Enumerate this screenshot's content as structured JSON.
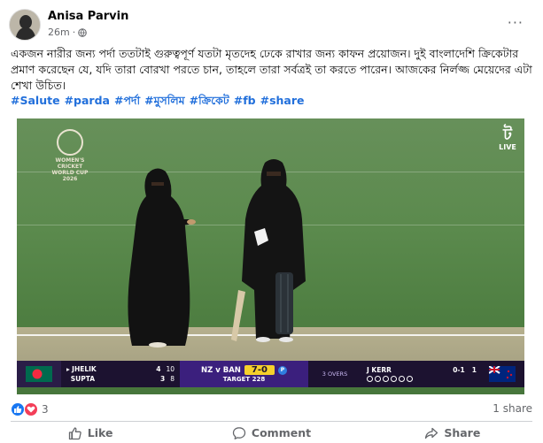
{
  "post": {
    "author": "Anisa Parvin",
    "time": "26m",
    "separator": "·",
    "more_label": "···",
    "text": "একজন নারীর জন্য পর্দা ততটাই গুরুত্বপূর্ণ যতটা মৃতদেহ ঢেকে রাখার জন্য কাফন প্রয়োজন। দুই বাংলাদেশি ক্রিকেটার প্রমাণ করেছেন যে, যদি তারা বোরখা পরতে চান, তাহলে তারা সর্বত্রই তা করতে পারেন। আজকের নির্লজ্জ মেয়েদের এটা শেখা উচিত।",
    "hashtags": [
      "#Salute",
      "#parda",
      "#পর্দা",
      "#মুসলিম",
      "#ক্রিকেট",
      "#fb",
      "#share"
    ]
  },
  "media": {
    "logo_text_1": "WOMEN'S CRICKET",
    "logo_text_2": "WORLD CUP",
    "logo_text_3": "2026",
    "live_label": "LIVE",
    "live_glyph": "ট",
    "scoreboard": {
      "batters": [
        {
          "name": "JHELIK",
          "runs": "4",
          "balls": "10",
          "marker": "▸"
        },
        {
          "name": "SUPTA",
          "runs": "3",
          "balls": "8",
          "marker": ""
        }
      ],
      "teams": "NZ v BAN",
      "score": "7-0",
      "powerplay": "P",
      "overs": "3 OVERS",
      "target": "TARGET 228",
      "bowler": "J KERR",
      "bowler_figures": "0-1",
      "bowler_overs": "1",
      "balls_remaining": 6
    }
  },
  "reactions": {
    "count": "3",
    "shares": "1 share",
    "colors": {
      "like": "#1877f2",
      "love": "#f33e58"
    }
  },
  "actions": {
    "like": "Like",
    "comment": "Comment",
    "share": "Share"
  }
}
